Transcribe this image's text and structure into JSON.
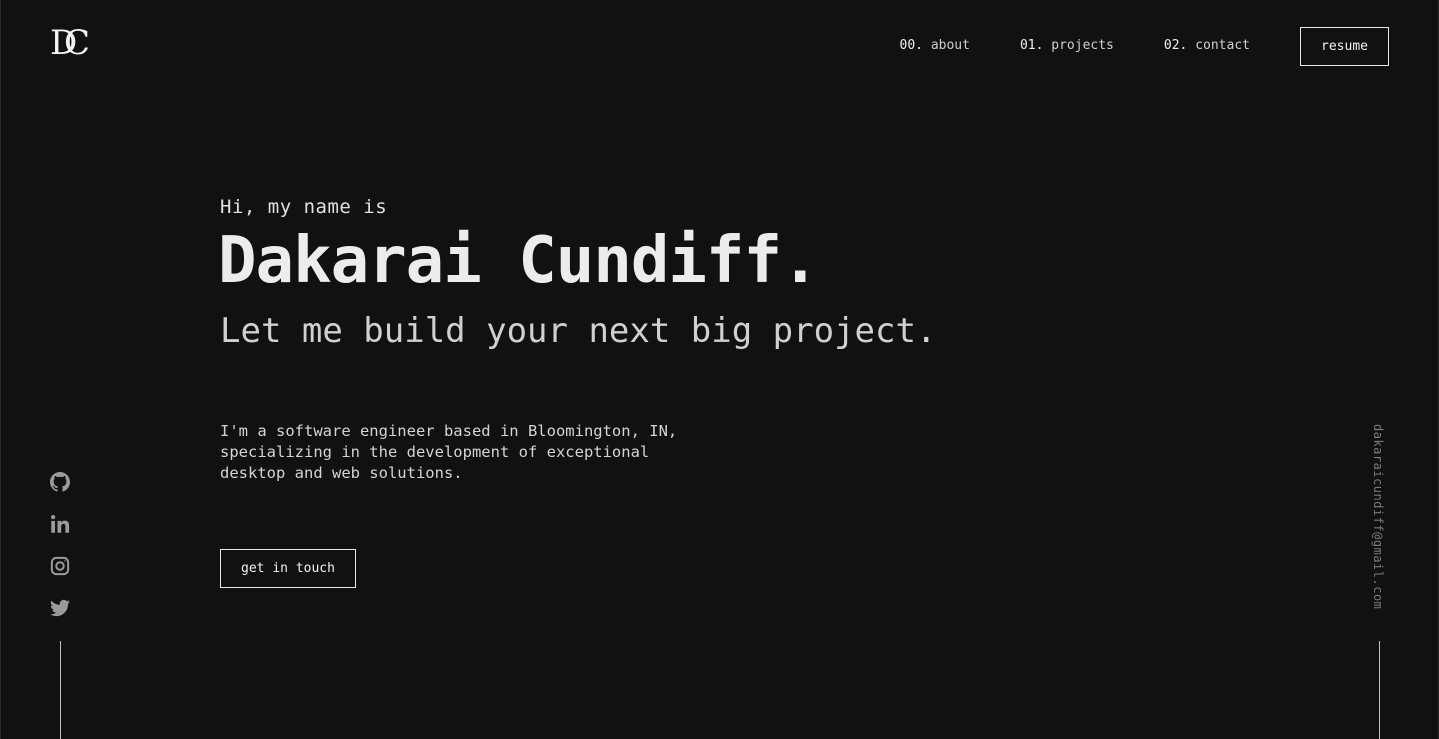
{
  "logo": {
    "letter_d": "D",
    "letter_c": "C"
  },
  "nav": {
    "items": [
      {
        "num": "00.",
        "label": "about"
      },
      {
        "num": "01.",
        "label": "projects"
      },
      {
        "num": "02.",
        "label": "contact"
      }
    ],
    "resume_label": "resume"
  },
  "hero": {
    "greeting": "Hi, my name is",
    "name": "Dakarai Cundiff.",
    "tagline": "Let me build your next big project.",
    "bio_lines": [
      "I'm a software engineer based in Bloomington, IN,",
      "specializing in the development of exceptional",
      "desktop and web solutions."
    ],
    "cta_label": "get in touch"
  },
  "socials": [
    {
      "icon": "github-icon"
    },
    {
      "icon": "linkedin-icon"
    },
    {
      "icon": "instagram-icon"
    },
    {
      "icon": "twitter-icon"
    }
  ],
  "email": "dakaraicundiff@gmail.com",
  "colors": {
    "background": "#111111",
    "text": "#e6e6e6",
    "muted": "#7a7a7a",
    "border": "#e8e8e8"
  }
}
